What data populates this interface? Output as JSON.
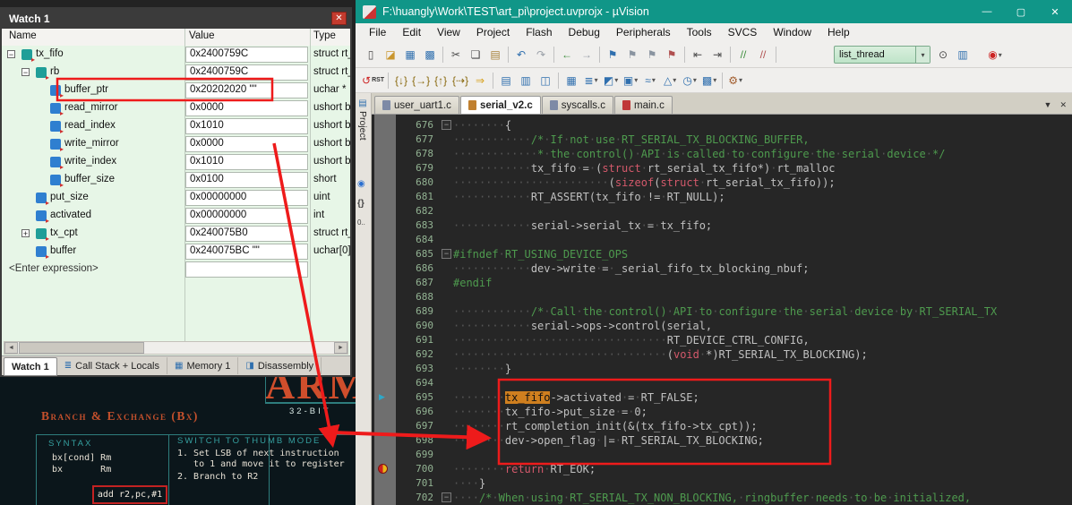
{
  "colors": {
    "titlebar_teal": "#109688",
    "annotation_red": "#ee1b1b",
    "editor_bg": "#262626",
    "comment_green": "#4e9a4e",
    "keyword_red": "#d4596b",
    "search_highlight_orange": "#cf7f1f",
    "watch_bg_green": "#e7f6e7",
    "slide_accent_orange": "#c4502c",
    "slide_accent_teal": "#2fa0a0"
  },
  "watch_window": {
    "title": "Watch 1",
    "close_glyph": "✕",
    "columns": [
      "Name",
      "Value",
      "Type"
    ],
    "rows": [
      {
        "name": "tx_fifo",
        "value": "0x2400759C",
        "type": "struct rt_",
        "level": 0,
        "exp": "minus",
        "icon": "struct"
      },
      {
        "name": "rb",
        "value": "0x2400759C",
        "type": "struct rt_",
        "level": 1,
        "exp": "minus",
        "icon": "struct"
      },
      {
        "name": "buffer_ptr",
        "value": "0x20202020 \"\"",
        "type": "uchar *",
        "level": 2,
        "icon": "leaf"
      },
      {
        "name": "read_mirror",
        "value": "0x0000",
        "type": "ushort bi",
        "level": 2,
        "icon": "leaf"
      },
      {
        "name": "read_index",
        "value": "0x1010",
        "type": "ushort bi",
        "level": 2,
        "icon": "leaf"
      },
      {
        "name": "write_mirror",
        "value": "0x0000",
        "type": "ushort bi",
        "level": 2,
        "icon": "leaf"
      },
      {
        "name": "write_index",
        "value": "0x1010",
        "type": "ushort bi",
        "level": 2,
        "icon": "leaf"
      },
      {
        "name": "buffer_size",
        "value": "0x0100",
        "type": "short",
        "level": 2,
        "icon": "leaf"
      },
      {
        "name": "put_size",
        "value": "0x00000000",
        "type": "uint",
        "level": 1,
        "icon": "leaf"
      },
      {
        "name": "activated",
        "value": "0x00000000",
        "type": "int",
        "level": 1,
        "icon": "leaf"
      },
      {
        "name": "tx_cpt",
        "value": "0x240075B0",
        "type": "struct rt_",
        "level": 1,
        "exp": "plus",
        "icon": "struct"
      },
      {
        "name": "buffer",
        "value": "0x240075BC \"\"",
        "type": "uchar[0]",
        "level": 1,
        "icon": "leaf"
      }
    ],
    "enter_row": "<Enter expression>",
    "scrollbar": {
      "left": "◄",
      "right": "►"
    },
    "dock_tabs": [
      {
        "label": "Watch 1",
        "active": true
      },
      {
        "label": "Call Stack + Locals",
        "icon": "callstack"
      },
      {
        "label": "Memory 1",
        "icon": "memory"
      },
      {
        "label": "Disassembly",
        "icon": "disassembly"
      }
    ]
  },
  "slide": {
    "big_title": "ARM",
    "subtitle": "32-BIT",
    "section_title": "Branch & Exchange (Bx)",
    "syntax_heading": "SYNTAX",
    "syntax_lines": [
      "bx[cond] Rm",
      "bx       Rm"
    ],
    "thumb_heading": "SWITCH TO THUMB MODE",
    "thumb_lines": [
      "1. Set LSB of next instruction",
      "   to 1 and move it to register",
      "2. Branch to R2"
    ],
    "code_chip": "add  r2,pc,#1"
  },
  "main_window": {
    "title": "F:\\huangly\\Work\\TEST\\art_pi\\project.uvprojx - µVision",
    "window_buttons": {
      "minimize": "—",
      "maximize": "▢",
      "close": "✕"
    },
    "menu": [
      "File",
      "Edit",
      "View",
      "Project",
      "Flash",
      "Debug",
      "Peripherals",
      "Tools",
      "SVCS",
      "Window",
      "Help"
    ],
    "combo_value": "list_thread",
    "tab_controls": {
      "list": "▼",
      "close": "✕"
    },
    "toolbar_main": [
      {
        "name": "new-file-icon",
        "glyph": "▯",
        "color": "#4a4a4a"
      },
      {
        "name": "open-file-icon",
        "glyph": "◪",
        "color": "#c9962e"
      },
      {
        "name": "save-icon",
        "glyph": "▦",
        "color": "#2f6fae"
      },
      {
        "name": "save-all-icon",
        "glyph": "▩",
        "color": "#2f6fae"
      },
      {
        "sep": true
      },
      {
        "name": "cut-icon",
        "glyph": "✂",
        "color": "#4a4a4a"
      },
      {
        "name": "copy-icon",
        "glyph": "❏",
        "color": "#4a4a4a"
      },
      {
        "name": "paste-icon",
        "glyph": "▤",
        "color": "#a8823c"
      },
      {
        "sep": true
      },
      {
        "name": "undo-icon",
        "glyph": "↶",
        "color": "#2f6fae"
      },
      {
        "name": "redo-icon",
        "glyph": "↷",
        "color": "#9aa0a8"
      },
      {
        "sep": true
      },
      {
        "name": "nav-back-icon",
        "glyph": "←",
        "color": "#3f8f3f"
      },
      {
        "name": "nav-forward-icon",
        "glyph": "→",
        "color": "#9aa0a8"
      },
      {
        "sep": true
      },
      {
        "name": "toggle-bookmark-icon",
        "glyph": "⚑",
        "color": "#2f6fae"
      },
      {
        "name": "prev-bookmark-icon",
        "glyph": "⚑",
        "color": "#8a94a0"
      },
      {
        "name": "next-bookmark-icon",
        "glyph": "⚑",
        "color": "#8a94a0"
      },
      {
        "name": "clear-bookmarks-icon",
        "glyph": "⚑",
        "color": "#b05050"
      },
      {
        "sep": true
      },
      {
        "name": "unindent-icon",
        "glyph": "⇤",
        "color": "#4a4a4a"
      },
      {
        "name": "indent-icon",
        "glyph": "⇥",
        "color": "#4a4a4a"
      },
      {
        "sep": true
      },
      {
        "name": "comment-icon",
        "glyph": "//",
        "color": "#3f8f3f"
      },
      {
        "name": "uncomment-icon",
        "glyph": "//",
        "color": "#b05050"
      },
      {
        "sep": true
      },
      {
        "space": 58
      },
      {
        "combo": true
      },
      {
        "name": "find-in-files-icon",
        "glyph": "⊙",
        "color": "#4a4a4a"
      },
      {
        "name": "find-icon",
        "glyph": "▥",
        "color": "#2f6fae"
      },
      {
        "space": 14
      },
      {
        "name": "start-debug-icon",
        "glyph": "◉",
        "color": "#cc2222",
        "dd": true
      }
    ],
    "toolbar_debug": [
      {
        "name": "reset-icon",
        "glyph": "↺",
        "color": "#cc2222",
        "label": "RST"
      },
      {
        "sep": true
      },
      {
        "name": "step-into-icon",
        "glyph": "{↓}",
        "color": "#8a6a10"
      },
      {
        "name": "step-over-icon",
        "glyph": "{→}",
        "color": "#8a6a10"
      },
      {
        "name": "step-out-icon",
        "glyph": "{↑}",
        "color": "#8a6a10"
      },
      {
        "name": "run-to-line-icon",
        "glyph": "{⇢}",
        "color": "#8a6a10"
      },
      {
        "name": "show-next-statement-icon",
        "glyph": "⇒",
        "color": "#d8a018"
      },
      {
        "sep": true
      },
      {
        "name": "command-window-icon",
        "glyph": "▤",
        "color": "#2f6fae"
      },
      {
        "name": "disassembly-window-icon",
        "glyph": "▥",
        "color": "#2f6fae"
      },
      {
        "name": "symbols-window-icon",
        "glyph": "◫",
        "color": "#2f6fae"
      },
      {
        "sep": true
      },
      {
        "name": "registers-window-icon",
        "glyph": "▦",
        "color": "#2f6fae"
      },
      {
        "name": "callstack-window-icon",
        "glyph": "≣",
        "color": "#2f6fae",
        "dd": true
      },
      {
        "name": "watch-window-icon",
        "glyph": "◩",
        "color": "#2f6fae",
        "dd": true
      },
      {
        "name": "memory-window-icon",
        "glyph": "▣",
        "color": "#2f6fae",
        "dd": true
      },
      {
        "name": "serial-window-icon",
        "glyph": "≈",
        "color": "#2f6fae",
        "dd": true
      },
      {
        "name": "analysis-window-icon",
        "glyph": "△",
        "color": "#2f6fae",
        "dd": true
      },
      {
        "name": "trace-window-icon",
        "glyph": "◷",
        "color": "#2f6fae",
        "dd": true
      },
      {
        "name": "system-viewer-icon",
        "glyph": "▩",
        "color": "#2f6fae",
        "dd": true
      },
      {
        "sep": true
      },
      {
        "name": "toolbox-icon",
        "glyph": "⚙",
        "color": "#a05a2a",
        "dd": true
      }
    ],
    "side_tabs": {
      "project_label": "Project"
    },
    "file_tabs": [
      {
        "label": "user_uart1.c",
        "icon_color": "#7d8aa6"
      },
      {
        "label": "serial_v2.c",
        "active": true,
        "icon_color": "#c08030"
      },
      {
        "label": "syscalls.c",
        "icon_color": "#7d8aa6"
      },
      {
        "label": "main.c",
        "icon_color": "#c03838"
      }
    ],
    "editor": {
      "lines": [
        {
          "n": 676,
          "fold": true,
          "segs": [
            [
              "df",
              "        {"
            ]
          ]
        },
        {
          "n": 677,
          "segs": [
            [
              "cm",
              "            /* If not use RT_SERIAL_TX_BLOCKING_BUFFER,"
            ]
          ]
        },
        {
          "n": 678,
          "segs": [
            [
              "cm",
              "             * the control() API is called to configure the serial device */"
            ]
          ]
        },
        {
          "n": 679,
          "segs": [
            [
              "df",
              "            tx_fifo = ("
            ],
            [
              "kw",
              "struct"
            ],
            [
              "df",
              " rt_serial_tx_fifo*) rt_malloc"
            ]
          ]
        },
        {
          "n": 680,
          "segs": [
            [
              "df",
              "                        ("
            ],
            [
              "kw",
              "sizeof"
            ],
            [
              "df",
              "("
            ],
            [
              "kw",
              "struct"
            ],
            [
              "df",
              " rt_serial_tx_fifo));"
            ]
          ]
        },
        {
          "n": 681,
          "segs": [
            [
              "df",
              "            RT_ASSERT(tx_fifo != RT_NULL);"
            ]
          ]
        },
        {
          "n": 682,
          "segs": []
        },
        {
          "n": 683,
          "segs": [
            [
              "df",
              "            serial->serial_tx = tx_fifo;"
            ]
          ]
        },
        {
          "n": 684,
          "segs": []
        },
        {
          "n": 685,
          "fold": true,
          "segs": [
            [
              "pp",
              "#ifndef RT_USING_DEVICE_OPS"
            ]
          ]
        },
        {
          "n": 686,
          "segs": [
            [
              "df",
              "            dev->write = _serial_fifo_tx_blocking_nbuf;"
            ]
          ]
        },
        {
          "n": 687,
          "segs": [
            [
              "pp",
              "#endif"
            ]
          ]
        },
        {
          "n": 688,
          "segs": []
        },
        {
          "n": 689,
          "segs": [
            [
              "cm",
              "            /* Call the control() API to configure the serial device by RT_SERIAL_TX"
            ]
          ]
        },
        {
          "n": 690,
          "segs": [
            [
              "df",
              "            serial->ops->control(serial,"
            ]
          ]
        },
        {
          "n": 691,
          "segs": [
            [
              "df",
              "                                 RT_DEVICE_CTRL_CONFIG,"
            ]
          ]
        },
        {
          "n": 692,
          "segs": [
            [
              "df",
              "                                 ("
            ],
            [
              "kw",
              "void"
            ],
            [
              "df",
              " *)RT_SERIAL_TX_BLOCKING);"
            ]
          ]
        },
        {
          "n": 693,
          "segs": [
            [
              "df",
              "        }"
            ]
          ]
        },
        {
          "n": 694,
          "segs": []
        },
        {
          "n": 695,
          "gut": "arrow",
          "segs": [
            [
              "df",
              "        "
            ],
            [
              "hl",
              "tx_fifo"
            ],
            [
              "df",
              "->activated = RT_FALSE;"
            ]
          ]
        },
        {
          "n": 696,
          "segs": [
            [
              "df",
              "        tx_fifo->put_size = 0;"
            ]
          ]
        },
        {
          "n": 697,
          "segs": [
            [
              "df",
              "        rt_completion_init(&(tx_fifo->tx_cpt));"
            ]
          ]
        },
        {
          "n": 698,
          "segs": [
            [
              "df",
              "        dev->open_flag |= RT_SERIAL_TX_BLOCKING;"
            ]
          ]
        },
        {
          "n": 699,
          "segs": []
        },
        {
          "n": 700,
          "gut": "pc",
          "segs": [
            [
              "df",
              "        "
            ],
            [
              "kw",
              "return"
            ],
            [
              "df",
              " RT_EOK;"
            ]
          ]
        },
        {
          "n": 701,
          "segs": [
            [
              "df",
              "    }"
            ]
          ]
        },
        {
          "n": 702,
          "fold": true,
          "segs": [
            [
              "cm",
              "    /* When using RT_SERIAL_TX_NON_BLOCKING, ringbuffer needs to be initialized,"
            ]
          ]
        }
      ]
    }
  }
}
